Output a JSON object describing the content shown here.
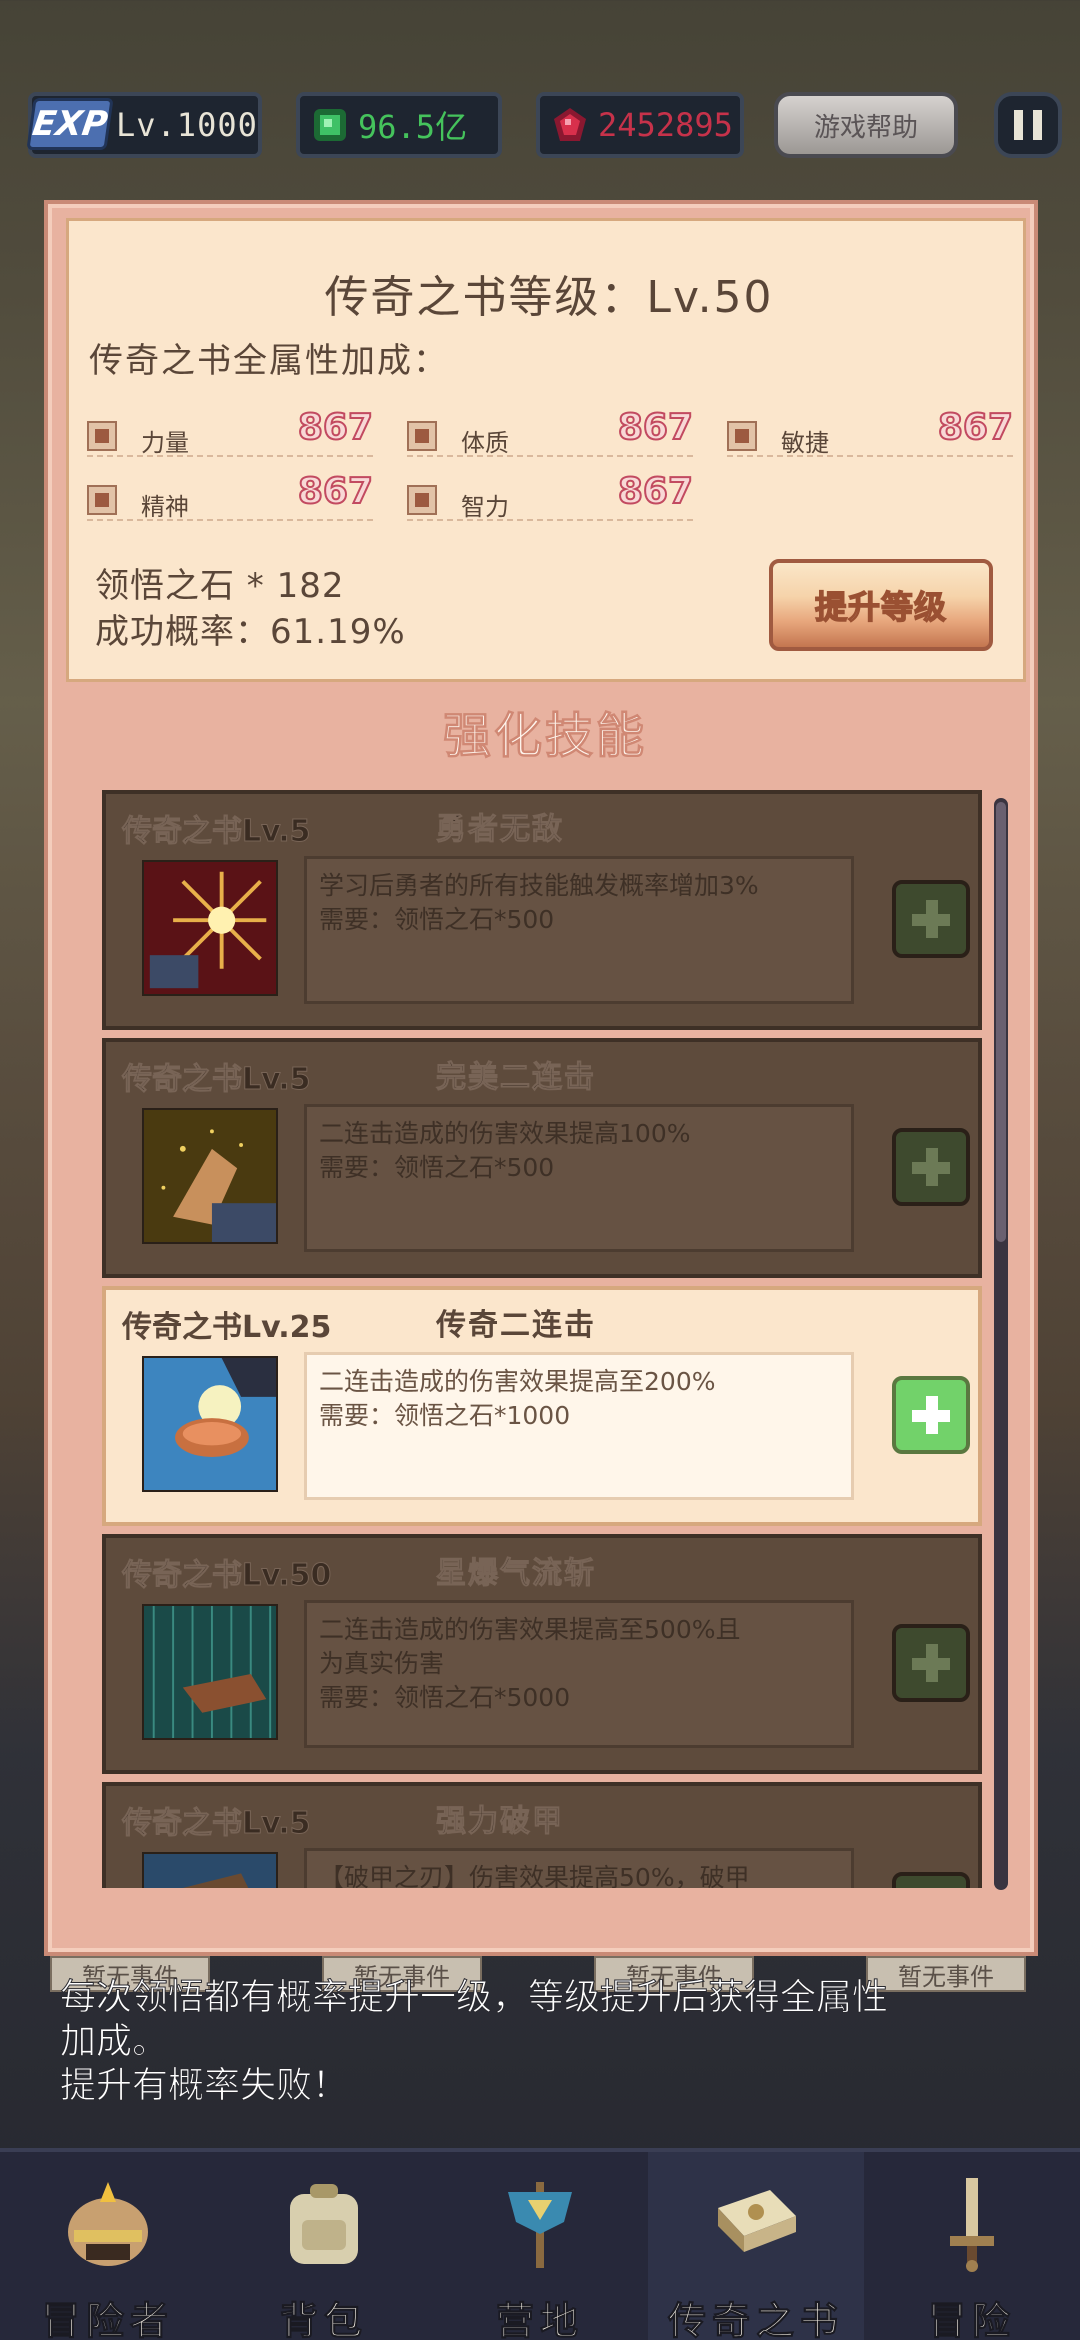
{
  "hud": {
    "exp_badge": "EXP",
    "level": "Lv.1000",
    "gold": "96.5亿",
    "gems": "2452895",
    "help_label": "游戏帮助"
  },
  "book": {
    "title": "传奇之书等级：Lv.50",
    "attr_heading": "传奇之书全属性加成：",
    "stats": [
      {
        "label": "力量",
        "value": "867",
        "icon": "strength-icon"
      },
      {
        "label": "体质",
        "value": "867",
        "icon": "heart-icon"
      },
      {
        "label": "敏捷",
        "value": "867",
        "icon": "boot-icon"
      },
      {
        "label": "精神",
        "value": "867",
        "icon": "spirit-icon"
      },
      {
        "label": "智力",
        "value": "867",
        "icon": "brain-icon"
      }
    ],
    "stone_line": "领悟之石 * 182",
    "rate_line": "成功概率：61.19%",
    "upgrade_label": "提升等级"
  },
  "section_title": "强化技能",
  "skills": [
    {
      "book": "传奇之书Lv.5",
      "name": "勇者无敌",
      "desc1": "学习后勇者的所有技能触发概率增加3%",
      "desc2": "需要：领悟之石*500",
      "desc3": "",
      "active": false,
      "icon": "burst-icon"
    },
    {
      "book": "传奇之书Lv.5",
      "name": "完美二连击",
      "desc1": "二连击造成的伤害效果提高100%",
      "desc2": "需要：领悟之石*500",
      "desc3": "",
      "active": false,
      "icon": "palm-strike-icon"
    },
    {
      "book": "传奇之书Lv.25",
      "name": "传奇二连击",
      "desc1": "二连击造成的伤害效果提高至200%",
      "desc2": "需要：领悟之石*1000",
      "desc3": "",
      "active": true,
      "icon": "glowing-fist-icon"
    },
    {
      "book": "传奇之书Lv.50",
      "name": "星爆气流斩",
      "desc1": "二连击造成的伤害效果提高至500%且",
      "desc2": "为真实伤害",
      "desc3": "需要：领悟之石*5000",
      "active": false,
      "icon": "rain-hand-icon"
    },
    {
      "book": "传奇之书Lv.5",
      "name": "强力破甲",
      "desc1": "【破甲之刃】伤害效果提高50%，破甲",
      "desc2": "",
      "desc3": "",
      "active": false,
      "icon": "armor-break-icon"
    }
  ],
  "events": [
    "暂无事件",
    "暂无事件",
    "暂无事件",
    "暂无事件"
  ],
  "hint": {
    "line1": "每次领悟都有概率提升一级，等级提升后获得全属性",
    "line2": "加成。",
    "line3": "提升有概率失败！"
  },
  "nav": [
    {
      "label": "冒险者",
      "icon": "helmet-icon"
    },
    {
      "label": "背包",
      "icon": "backpack-icon"
    },
    {
      "label": "营地",
      "icon": "camp-banner-icon"
    },
    {
      "label": "传奇之书",
      "icon": "book-icon"
    },
    {
      "label": "冒险",
      "icon": "sword-icon"
    }
  ],
  "colors": {
    "panel": "#e8b2a0",
    "card": "#fbe6cc",
    "gold": "#45c35c",
    "gem": "#c6324a",
    "stat_value": "#c24a60"
  }
}
